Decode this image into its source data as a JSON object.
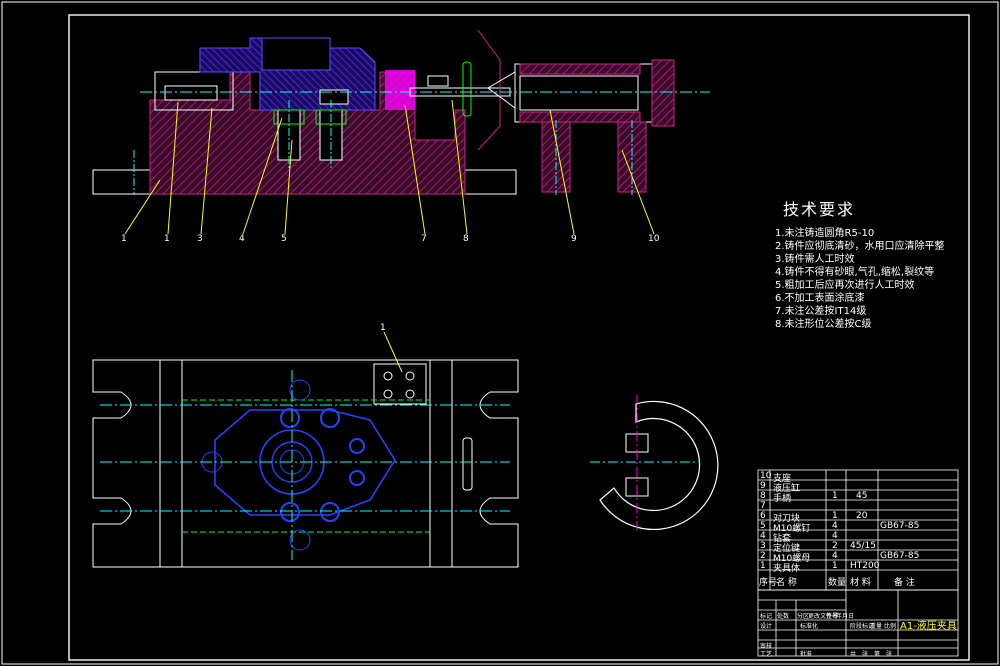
{
  "colors": {
    "background": "#000000",
    "border": "#ffffff",
    "hatch": "#cc2288",
    "fixture": "#4422ff",
    "leader": "#ffff00",
    "centerline": "#00ffff",
    "workpiece": "#2244ff",
    "guide": "#00ff00",
    "magenta": "#ff00ff"
  },
  "balloons": {
    "front": [
      "1",
      "1",
      "3",
      "4",
      "5",
      "7",
      "8",
      "9",
      "10"
    ],
    "plan": [
      "1"
    ]
  },
  "technical_requirements": {
    "title": "技术要求",
    "items": [
      "1.未注铸造圆角R5-10",
      "2.铸件应彻底清砂，水用口应清除平整",
      "3.铸件需人工时效",
      "4.铸件不得有砂眼,气孔,缩松,裂纹等",
      "5.粗加工后应再次进行人工时效",
      "6.不加工表面涂底漆",
      "7.未注公差按IT14级",
      "8.未注形位公差按C级"
    ]
  },
  "parts_list": {
    "rows": [
      {
        "no": "10",
        "name": "支座",
        "qty": "",
        "material": "",
        "remark": ""
      },
      {
        "no": "9",
        "name": "液压缸",
        "qty": "",
        "material": "",
        "remark": ""
      },
      {
        "no": "8",
        "name": "手柄",
        "qty": "1",
        "material": "45",
        "remark": ""
      },
      {
        "no": "7",
        "name": "",
        "qty": "",
        "material": "",
        "remark": ""
      },
      {
        "no": "6",
        "name": "对刀块",
        "qty": "1",
        "material": "20",
        "remark": ""
      },
      {
        "no": "5",
        "name": "M10螺钉",
        "qty": "4",
        "material": "",
        "remark": "GB67-85"
      },
      {
        "no": "4",
        "name": "钻套",
        "qty": "4",
        "material": "",
        "remark": ""
      },
      {
        "no": "3",
        "name": "定位键",
        "qty": "2",
        "material": "45/15",
        "remark": ""
      },
      {
        "no": "2",
        "name": "M10螺母",
        "qty": "4",
        "material": "",
        "remark": "GB67-85"
      },
      {
        "no": "1",
        "name": "夹具体",
        "qty": "1",
        "material": "HT200",
        "remark": ""
      }
    ],
    "header": {
      "no": "序号",
      "name": "名    称",
      "qty": "数量",
      "material": "材   料",
      "remark": "备    注"
    }
  },
  "title_block": {
    "drawing_name": "A1-液压夹具",
    "labels": [
      "标记",
      "处数",
      "分区",
      "更改文件号",
      "签名",
      "年月日",
      "设计",
      "标准化",
      "阶段标记",
      "重量",
      "比例",
      "审核",
      "工艺",
      "批准",
      "共",
      "张",
      "第",
      "张"
    ]
  }
}
